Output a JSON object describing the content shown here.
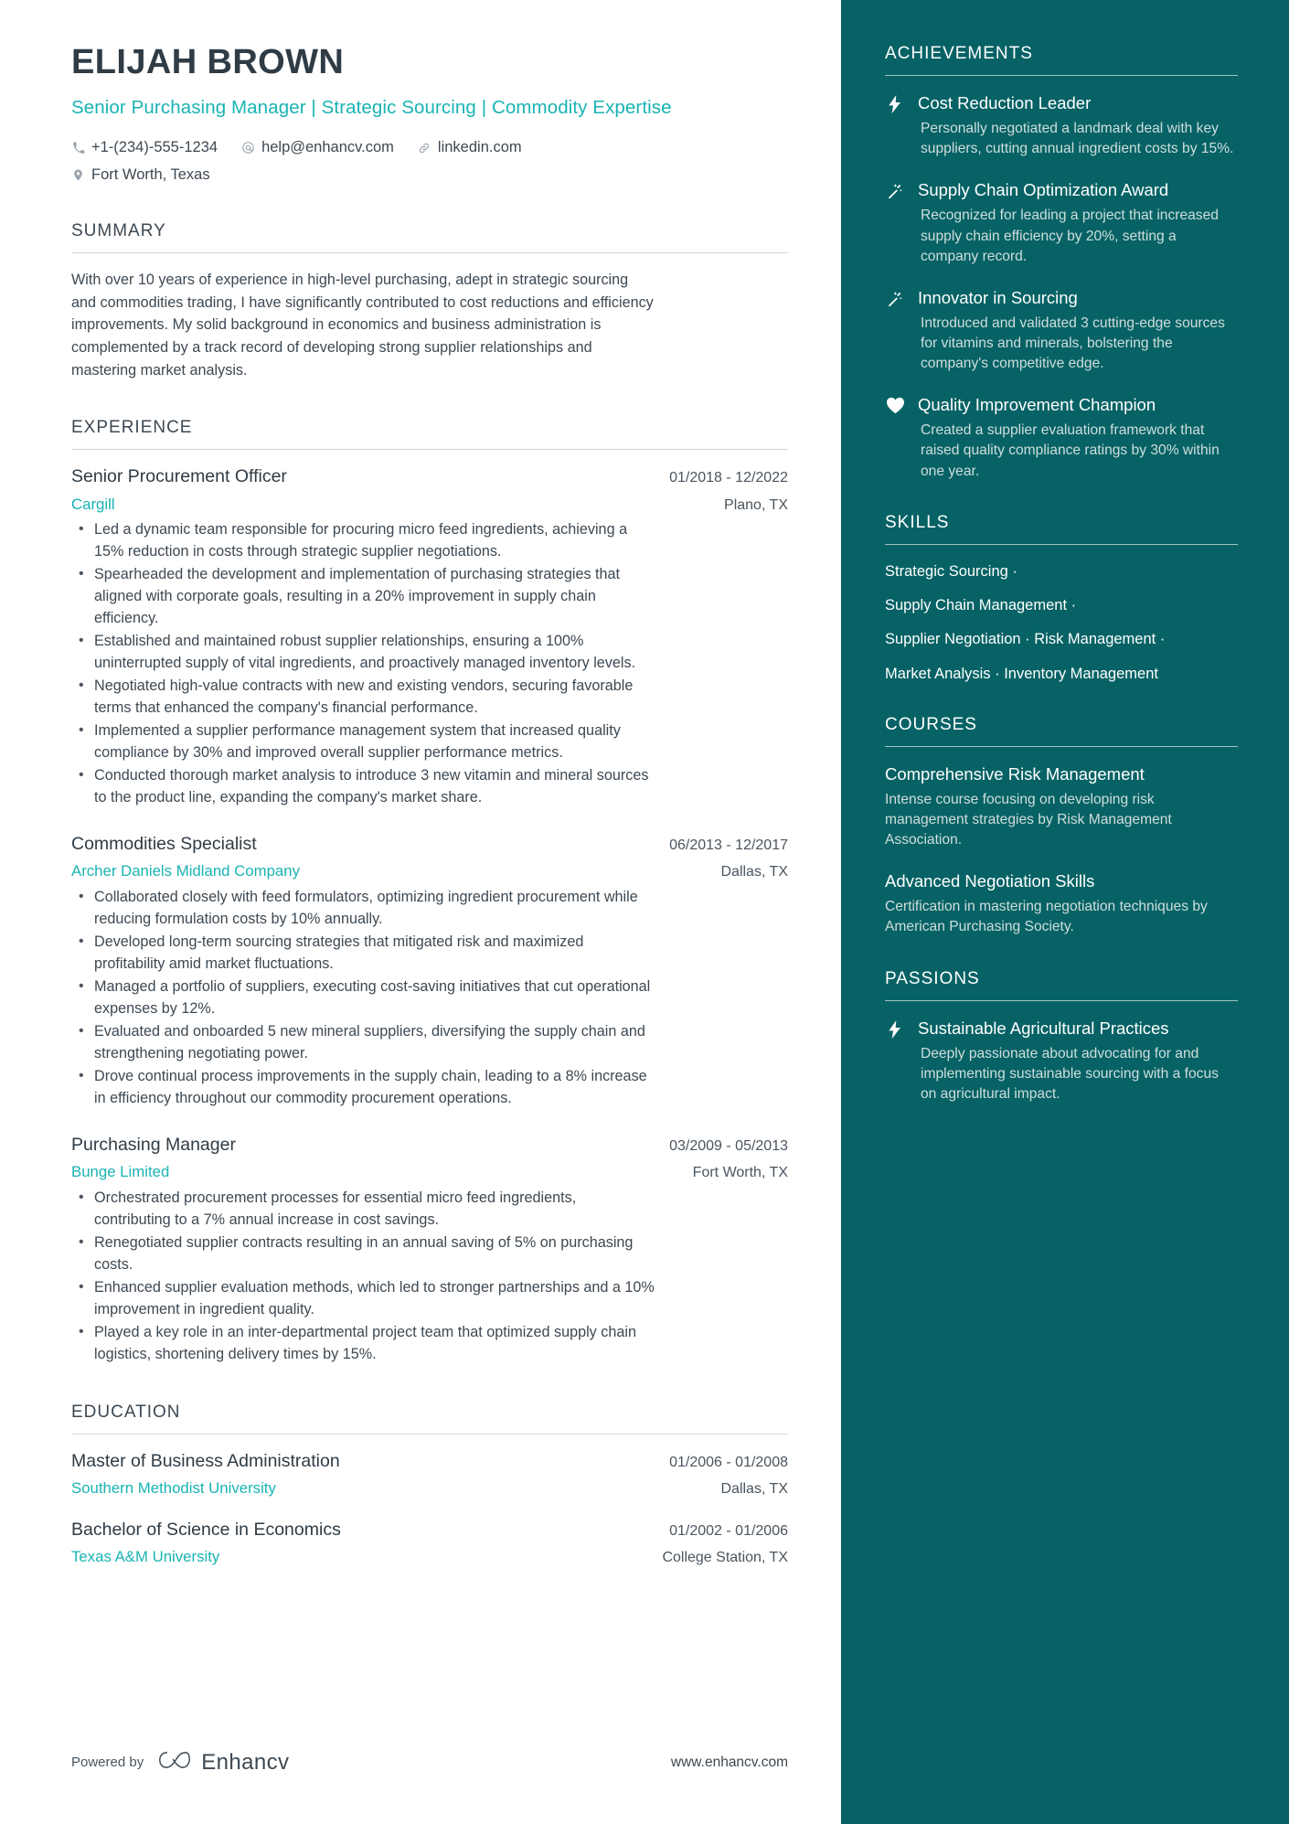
{
  "header": {
    "name": "ELIJAH BROWN",
    "headline": "Senior Purchasing Manager | Strategic Sourcing | Commodity Expertise",
    "contacts": [
      {
        "icon": "phone-icon",
        "text": "+1-(234)-555-1234"
      },
      {
        "icon": "email-icon",
        "text": "help@enhancv.com"
      },
      {
        "icon": "link-icon",
        "text": "linkedin.com"
      },
      {
        "icon": "location-icon",
        "text": "Fort Worth, Texas"
      }
    ]
  },
  "summary": {
    "title": "SUMMARY",
    "text": "With over 10 years of experience in high-level purchasing, adept in strategic sourcing and commodities trading, I have significantly contributed to cost reductions and efficiency improvements. My solid background in economics and business administration is complemented by a track record of developing strong supplier relationships and mastering market analysis."
  },
  "experience": {
    "title": "EXPERIENCE",
    "entries": [
      {
        "role": "Senior Procurement Officer",
        "dates": "01/2018 - 12/2022",
        "company": "Cargill",
        "location": "Plano, TX",
        "bullets": [
          "Led a dynamic team responsible for procuring micro feed ingredients, achieving a 15% reduction in costs through strategic supplier negotiations.",
          "Spearheaded the development and implementation of purchasing strategies that aligned with corporate goals, resulting in a 20% improvement in supply chain efficiency.",
          "Established and maintained robust supplier relationships, ensuring a 100% uninterrupted supply of vital ingredients, and proactively managed inventory levels.",
          "Negotiated high-value contracts with new and existing vendors, securing favorable terms that enhanced the company's financial performance.",
          "Implemented a supplier performance management system that increased quality compliance by 30% and improved overall supplier performance metrics.",
          "Conducted thorough market analysis to introduce 3 new vitamin and mineral sources to the product line, expanding the company's market share."
        ]
      },
      {
        "role": "Commodities Specialist",
        "dates": "06/2013 - 12/2017",
        "company": "Archer Daniels Midland Company",
        "location": "Dallas, TX",
        "bullets": [
          "Collaborated closely with feed formulators, optimizing ingredient procurement while reducing formulation costs by 10% annually.",
          "Developed long-term sourcing strategies that mitigated risk and maximized profitability amid market fluctuations.",
          "Managed a portfolio of suppliers, executing cost-saving initiatives that cut operational expenses by 12%.",
          "Evaluated and onboarded 5 new mineral suppliers, diversifying the supply chain and strengthening negotiating power.",
          "Drove continual process improvements in the supply chain, leading to a 8% increase in efficiency throughout our commodity procurement operations."
        ]
      },
      {
        "role": "Purchasing Manager",
        "dates": "03/2009 - 05/2013",
        "company": "Bunge Limited",
        "location": "Fort Worth, TX",
        "bullets": [
          "Orchestrated procurement processes for essential micro feed ingredients, contributing to a 7% annual increase in cost savings.",
          "Renegotiated supplier contracts resulting in an annual saving of 5% on purchasing costs.",
          "Enhanced supplier evaluation methods, which led to stronger partnerships and a 10% improvement in ingredient quality.",
          "Played a key role in an inter-departmental project team that optimized supply chain logistics, shortening delivery times by 15%."
        ]
      }
    ]
  },
  "education": {
    "title": "EDUCATION",
    "entries": [
      {
        "degree": "Master of Business Administration",
        "dates": "01/2006 - 01/2008",
        "school": "Southern Methodist University",
        "location": "Dallas, TX"
      },
      {
        "degree": "Bachelor of Science in Economics",
        "dates": "01/2002 - 01/2006",
        "school": "Texas A&M University",
        "location": "College Station, TX"
      }
    ]
  },
  "achievements": {
    "title": "ACHIEVEMENTS",
    "items": [
      {
        "icon": "bolt-icon",
        "title": "Cost Reduction Leader",
        "desc": "Personally negotiated a landmark deal with key suppliers, cutting annual ingredient costs by 15%."
      },
      {
        "icon": "magic-wand-icon",
        "title": "Supply Chain Optimization Award",
        "desc": "Recognized for leading a project that increased supply chain efficiency by 20%, setting a company record."
      },
      {
        "icon": "magic-wand-icon",
        "title": "Innovator in Sourcing",
        "desc": "Introduced and validated 3 cutting-edge sources for vitamins and minerals, bolstering the company's competitive edge."
      },
      {
        "icon": "heart-icon",
        "title": "Quality Improvement Champion",
        "desc": "Created a supplier evaluation framework that raised quality compliance ratings by 30% within one year."
      }
    ]
  },
  "skills": {
    "title": "SKILLS",
    "lines": [
      "Strategic Sourcing ·",
      "Supply Chain Management ·",
      "Supplier Negotiation · Risk Management ·",
      "Market Analysis · Inventory Management"
    ]
  },
  "courses": {
    "title": "COURSES",
    "items": [
      {
        "title": "Comprehensive Risk Management",
        "desc": "Intense course focusing on developing risk management strategies by Risk Management Association."
      },
      {
        "title": "Advanced Negotiation Skills",
        "desc": "Certification in mastering negotiation techniques by American Purchasing Society."
      }
    ]
  },
  "passions": {
    "title": "PASSIONS",
    "items": [
      {
        "icon": "bolt-icon",
        "title": "Sustainable Agricultural Practices",
        "desc": "Deeply passionate about advocating for and implementing sustainable sourcing with a focus on agricultural impact."
      }
    ]
  },
  "footer": {
    "powered_by": "Powered by",
    "brand": "Enhancv",
    "url": "www.enhancv.com"
  },
  "colors": {
    "accent_teal": "#1ab3b3",
    "sidebar_bg": "#076265",
    "text_dark": "#3d4852"
  }
}
